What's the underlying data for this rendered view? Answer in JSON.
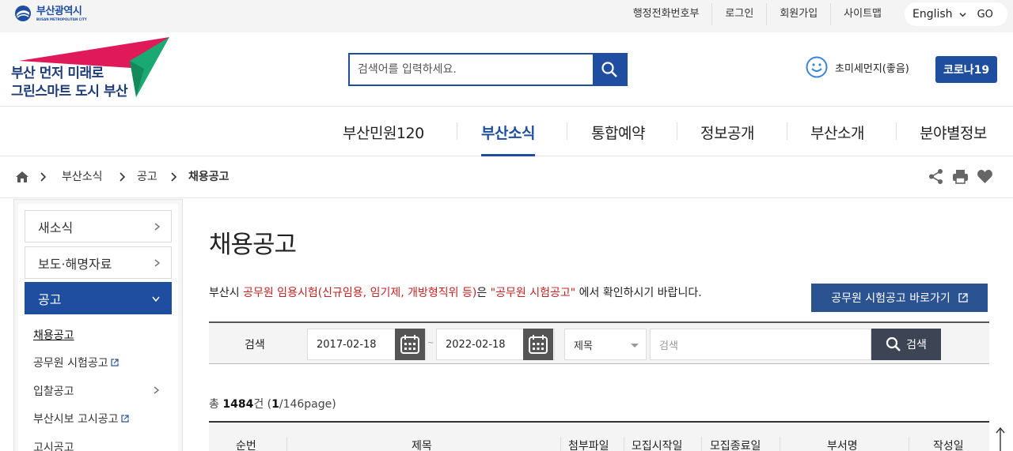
{
  "topbar": {
    "logo_ko": "부산광역시",
    "logo_en": "BUSAN METROPOLITAN CITY",
    "links": [
      "행정전화번호부",
      "로그인",
      "회원가입",
      "사이트맵"
    ],
    "language": "English",
    "go": "GO"
  },
  "header": {
    "slogan_line1": "부산 먼저 미래로",
    "slogan_line2": "그린스마트 도시 부산",
    "search_placeholder": "검색어를 입력하세요.",
    "air_quality": "초미세먼지(좋음)",
    "covid_button": "코로나19"
  },
  "gnb": [
    "부산민원120",
    "부산소식",
    "통합예약",
    "정보공개",
    "부산소개",
    "분야별정보"
  ],
  "breadcrumb": [
    "부산소식",
    "공고",
    "채용공고"
  ],
  "lnb": {
    "menus": [
      "새소식",
      "보도·해명자료",
      "공고"
    ],
    "subs": [
      "채용공고",
      "공무원 시험공고",
      "입찰공고",
      "부산시보 고시공고",
      "고시공고"
    ]
  },
  "content": {
    "title": "채용공고",
    "notice_pre": "부산시 ",
    "notice_red1": "공무원 임용시험(신규임용, 임기제, 개방형직위 등)",
    "notice_mid": "은 ",
    "notice_red2": "\"공무원 시험공고\"",
    "notice_post": " 에서 확인하시기 바랍니다.",
    "shortcut_button": "공무원 시험공고 바로가기"
  },
  "search_form": {
    "label": "검색",
    "start_date": "2017-02-18",
    "end_date": "2022-02-18",
    "tilde": "~",
    "field": "제목",
    "keyword_placeholder": "검색",
    "button": "검색"
  },
  "summary": {
    "prefix": "총 ",
    "count": "1484",
    "suffix1": "건 (",
    "page": "1",
    "suffix2": "/146page)"
  },
  "table_headers": [
    "순번",
    "제목",
    "첨부파일",
    "모집시작일",
    "모집종료일",
    "부서명",
    "작성일"
  ],
  "colors": {
    "primary": "#1f4ea1",
    "accent_red": "#c62121",
    "logo_pink": "#e0195a",
    "logo_green": "#1aa873"
  }
}
